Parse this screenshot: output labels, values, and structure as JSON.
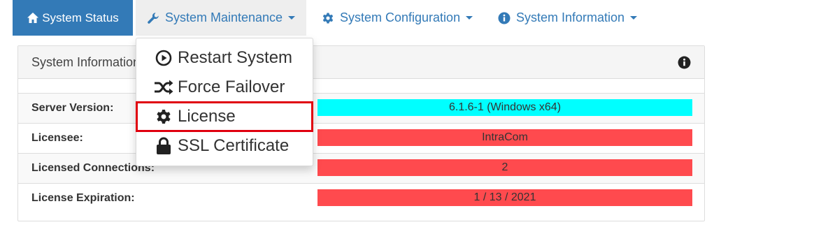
{
  "nav": {
    "tabs": [
      {
        "label": "System Status",
        "icon": "home-icon",
        "active": true
      },
      {
        "label": "System Maintenance",
        "icon": "wrench-icon",
        "open": true
      },
      {
        "label": "System Configuration",
        "icon": "gear-icon"
      },
      {
        "label": "System Information",
        "icon": "info-circle-icon"
      }
    ]
  },
  "dropdown": {
    "items": [
      {
        "label": "Restart System",
        "icon": "play-circle-icon"
      },
      {
        "label": "Force Failover",
        "icon": "shuffle-icon"
      },
      {
        "label": "License",
        "icon": "gear-icon",
        "highlighted": true
      },
      {
        "label": "SSL Certificate",
        "icon": "lock-icon"
      }
    ]
  },
  "panel": {
    "title": "System Information",
    "rows": [
      {
        "label": "Server Version:",
        "value": "6.1.6-1 (Windows x64)",
        "status_color": "#00ffff"
      },
      {
        "label": "Licensee:",
        "value": "IntraCom",
        "status_color": "#ff4a4e"
      },
      {
        "label": "Licensed Connections:",
        "value": "2",
        "status_color": "#ff4a4e"
      },
      {
        "label": "License Expiration:",
        "value": "1 / 13 / 2021",
        "status_color": "#ff4a4e"
      }
    ]
  },
  "colors": {
    "accent": "#337ab7",
    "highlight_outline": "#e0000f"
  }
}
